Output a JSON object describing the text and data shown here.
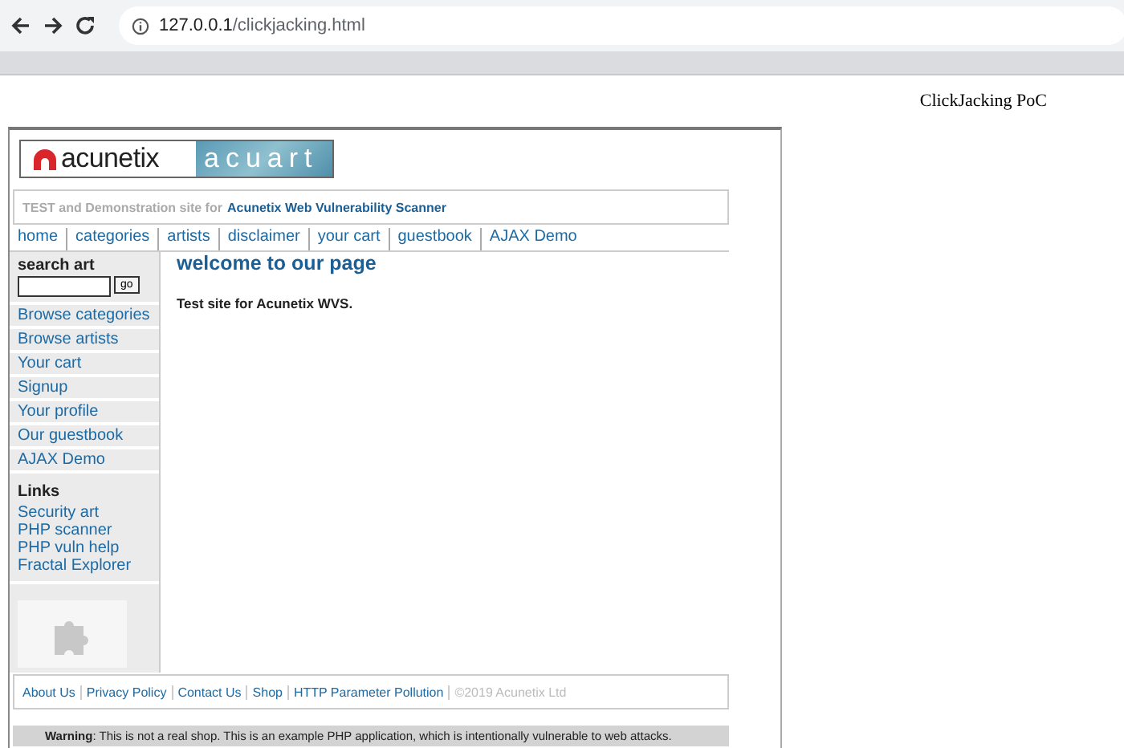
{
  "browser": {
    "url_host": "127.0.0.1",
    "url_path": "/clickjacking.html"
  },
  "page_title": "ClickJacking PoC",
  "site": {
    "logo": {
      "brand": "acunetix",
      "product": "acuart"
    },
    "tagline": {
      "text": "TEST and Demonstration site for",
      "link": "Acunetix Web Vulnerability Scanner"
    },
    "nav": [
      "home",
      "categories",
      "artists",
      "disclaimer",
      "your cart",
      "guestbook",
      "AJAX Demo"
    ],
    "search": {
      "label": "search art",
      "button": "go"
    },
    "menu": [
      "Browse categories",
      "Browse artists",
      "Your cart",
      "Signup",
      "Your profile",
      "Our guestbook",
      "AJAX Demo"
    ],
    "links": {
      "heading": "Links",
      "items": [
        "Security art",
        "PHP scanner",
        "PHP vuln help",
        "Fractal Explorer"
      ]
    },
    "content": {
      "heading": "welcome to our page",
      "text": "Test site for Acunetix WVS."
    },
    "footer": {
      "links": [
        "About Us",
        "Privacy Policy",
        "Contact Us",
        "Shop",
        "HTTP Parameter Pollution"
      ],
      "copyright": "©2019 Acunetix Ltd"
    },
    "warning": "**Warning**: This is not a real shop. This is an example PHP application, which is intentionally vulnerable to web attacks."
  }
}
